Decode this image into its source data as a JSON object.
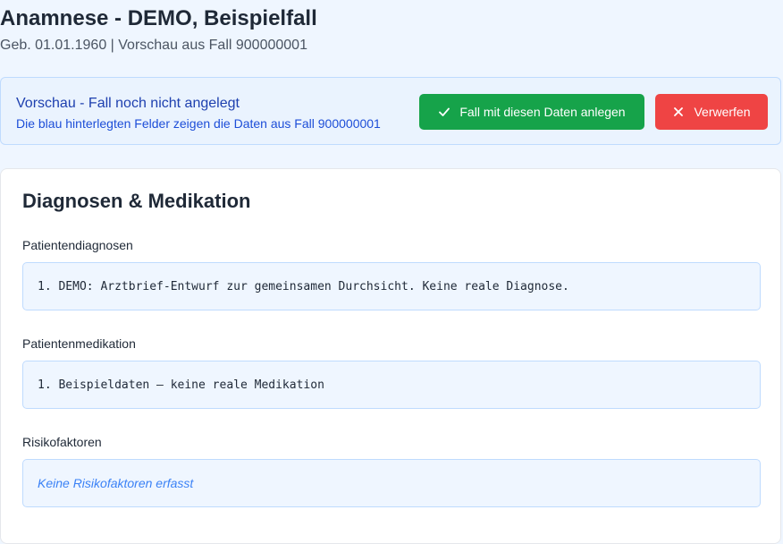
{
  "header": {
    "title": "Anamnese - DEMO, Beispielfall",
    "subtitle": "Geb. 01.01.1960 | Vorschau aus Fall 900000001"
  },
  "preview_banner": {
    "title": "Vorschau - Fall noch nicht angelegt",
    "description": "Die blau hinterlegten Felder zeigen die Daten aus Fall 900000001",
    "create_label": "Fall mit diesen Daten anlegen",
    "discard_label": "Verwerfen",
    "create_icon": "check-icon",
    "discard_icon": "close-icon",
    "colors": {
      "create": "#16a34a",
      "discard": "#ef4444",
      "accent": "#1e40af"
    }
  },
  "section": {
    "title": "Diagnosen & Medikation",
    "fields": {
      "diagnoses": {
        "label": "Patientendiagnosen",
        "value": "1. DEMO: Arztbrief-Entwurf zur gemeinsamen Durchsicht. Keine reale Diagnose."
      },
      "medication": {
        "label": "Patientenmedikation",
        "value": "1. Beispieldaten – keine reale Medikation"
      },
      "risk_factors": {
        "label": "Risikofaktoren",
        "value": "Keine Risikofaktoren erfasst"
      }
    }
  }
}
